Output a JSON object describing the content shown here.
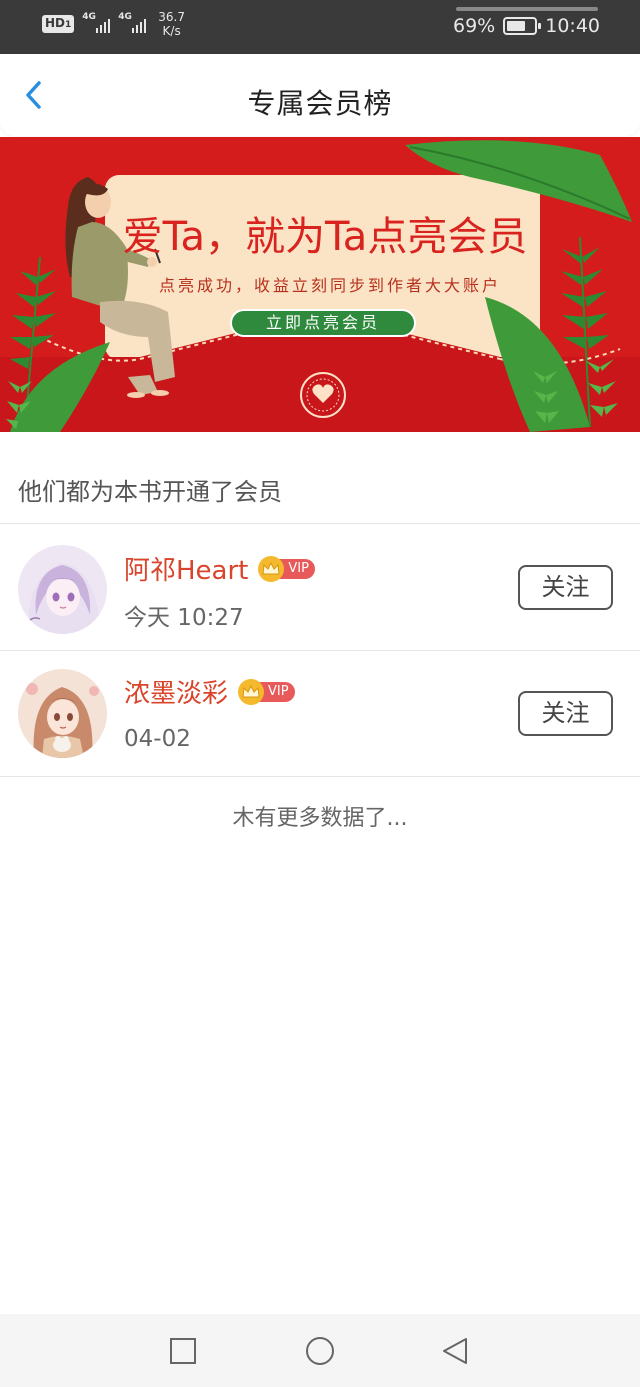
{
  "status_bar": {
    "hd": "HD",
    "hd_sub": "1",
    "net1": "4G",
    "net2": "4G",
    "speed_value": "36.7",
    "speed_unit": "K/s",
    "battery_pct": "69%",
    "battery_level": 0.69,
    "time": "10:40"
  },
  "header": {
    "title": "专属会员榜",
    "back_icon": "chevron-left-icon"
  },
  "banner": {
    "title": "爱Ta，就为Ta点亮会员",
    "subtitle": "点亮成功，收益立刻同步到作者大大账户",
    "button_label": "立即点亮会员",
    "colors": {
      "background": "#d41c1c",
      "card": "#fbe3c6",
      "leaf": "#3f9b3a",
      "button": "#2f8a3e"
    }
  },
  "section": {
    "title": "他们都为本书开通了会员"
  },
  "members": [
    {
      "name": "阿祁Heart",
      "vip_label": "VIP",
      "time": "今天 10:27",
      "follow_label": "关注"
    },
    {
      "name": "浓墨淡彩",
      "vip_label": "VIP",
      "time": "04-02",
      "follow_label": "关注"
    }
  ],
  "footer": {
    "no_more": "木有更多数据了..."
  },
  "nav_bar": {
    "icons": [
      "square-icon",
      "circle-icon",
      "triangle-back-icon"
    ]
  },
  "colors": {
    "accent_blue": "#2a8ee0",
    "name_red": "#d9442b",
    "vip_red": "#e85a5a",
    "crown_gold": "#f5b92d"
  }
}
